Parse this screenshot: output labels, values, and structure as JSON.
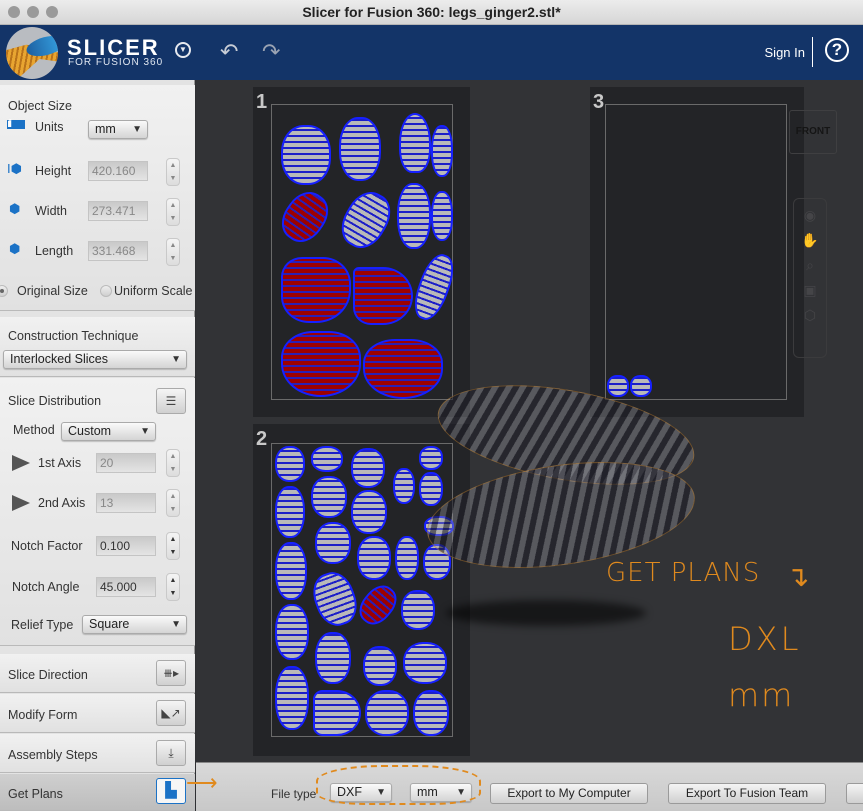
{
  "window": {
    "title": "Slicer for Fusion 360: legs_ginger2.stl*"
  },
  "header": {
    "brand": "SLICER",
    "brand_sub": "FOR FUSION 360",
    "menu_icon": "chevron-down-circle-icon",
    "undo_icon": "undo-icon",
    "redo_icon": "redo-icon",
    "sign_in": "Sign In",
    "help": "?"
  },
  "sidebar": {
    "object_size": {
      "title": "Object Size",
      "units_label": "Units",
      "units_value": "mm",
      "height_label": "Height",
      "height_value": "420.160",
      "width_label": "Width",
      "width_value": "273.471",
      "length_label": "Length",
      "length_value": "331.468",
      "original_size": "Original Size",
      "uniform_scale": "Uniform Scale",
      "selected_scale": "Original Size"
    },
    "construction": {
      "title": "Construction Technique",
      "value": "Interlocked Slices"
    },
    "distribution": {
      "title": "Slice Distribution",
      "method_label": "Method",
      "method_value": "Custom",
      "axis1_label": "1st Axis",
      "axis1_value": "20",
      "axis2_label": "2nd Axis",
      "axis2_value": "13",
      "notch_factor_label": "Notch Factor",
      "notch_factor_value": "0.100",
      "notch_angle_label": "Notch Angle",
      "notch_angle_value": "45.000",
      "relief_label": "Relief Type",
      "relief_value": "Square"
    },
    "steps": [
      {
        "label": "Slice Direction",
        "icon": "slice-direction-icon"
      },
      {
        "label": "Modify Form",
        "icon": "modify-form-icon"
      },
      {
        "label": "Assembly Steps",
        "icon": "assembly-steps-icon"
      },
      {
        "label": "Get Plans",
        "icon": "get-plans-icon"
      }
    ]
  },
  "canvas": {
    "sheets": [
      {
        "number": "1"
      },
      {
        "number": "2"
      },
      {
        "number": "3"
      }
    ],
    "viewcube_label": "FRONT",
    "annotations": {
      "line1": "GET PLANS",
      "line2": "DXL",
      "line3": "mm"
    }
  },
  "bottombar": {
    "file_type_label": "File type",
    "file_type_value": "DXF",
    "units_value": "mm",
    "export_computer": "Export to My Computer",
    "export_team": "Export To Fusion Team"
  },
  "colors": {
    "header_bg": "#133468",
    "annotation": "#e08a1e",
    "slice_outline": "#1620ff",
    "slice_fill": "#b9b9b9",
    "slice_red": "#9e0000"
  }
}
